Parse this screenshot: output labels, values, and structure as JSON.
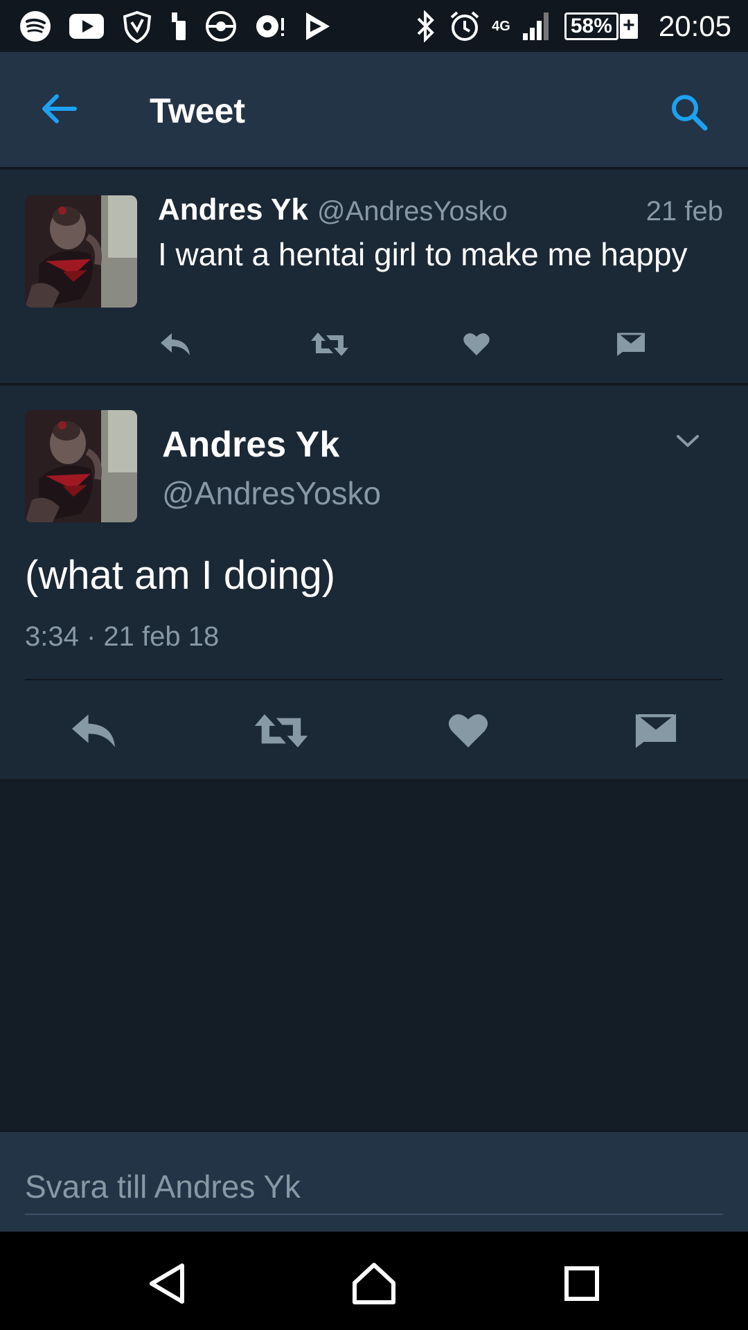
{
  "status_bar": {
    "left_icons": [
      "spotify-icon",
      "youtube-icon",
      "shield-app-icon",
      "device-icon",
      "pokeball-icon",
      "notification-icon",
      "play-store-icon"
    ],
    "network": "4G",
    "battery": "58%",
    "battery_charging": "+",
    "time": "20:05"
  },
  "app_bar": {
    "title": "Tweet",
    "back_icon": "back-arrow-icon",
    "search_icon": "search-icon",
    "accent_color": "#1da1f2"
  },
  "parent_tweet": {
    "name": "Andres Yk",
    "handle": "@AndresYosko",
    "date": "21 feb",
    "text": "I want a hentai girl to make me happy",
    "actions": [
      "reply-icon",
      "retweet-icon",
      "like-icon",
      "dm-icon"
    ]
  },
  "main_tweet": {
    "name": "Andres Yk",
    "handle": "@AndresYosko",
    "text": "(what am I doing)",
    "timestamp": "3:34 · 21 feb 18",
    "actions": [
      "reply-icon",
      "retweet-icon",
      "like-icon",
      "dm-icon"
    ]
  },
  "reply_bar": {
    "placeholder": "Svara till Andres Yk"
  },
  "nav_bar": {
    "buttons": [
      "back-triangle-icon",
      "home-icon",
      "recents-icon"
    ]
  },
  "colors": {
    "background": "#141d26",
    "card": "#1b2836",
    "header": "#243447",
    "muted_text": "#8899a6",
    "icon_gray": "#8899a6"
  }
}
